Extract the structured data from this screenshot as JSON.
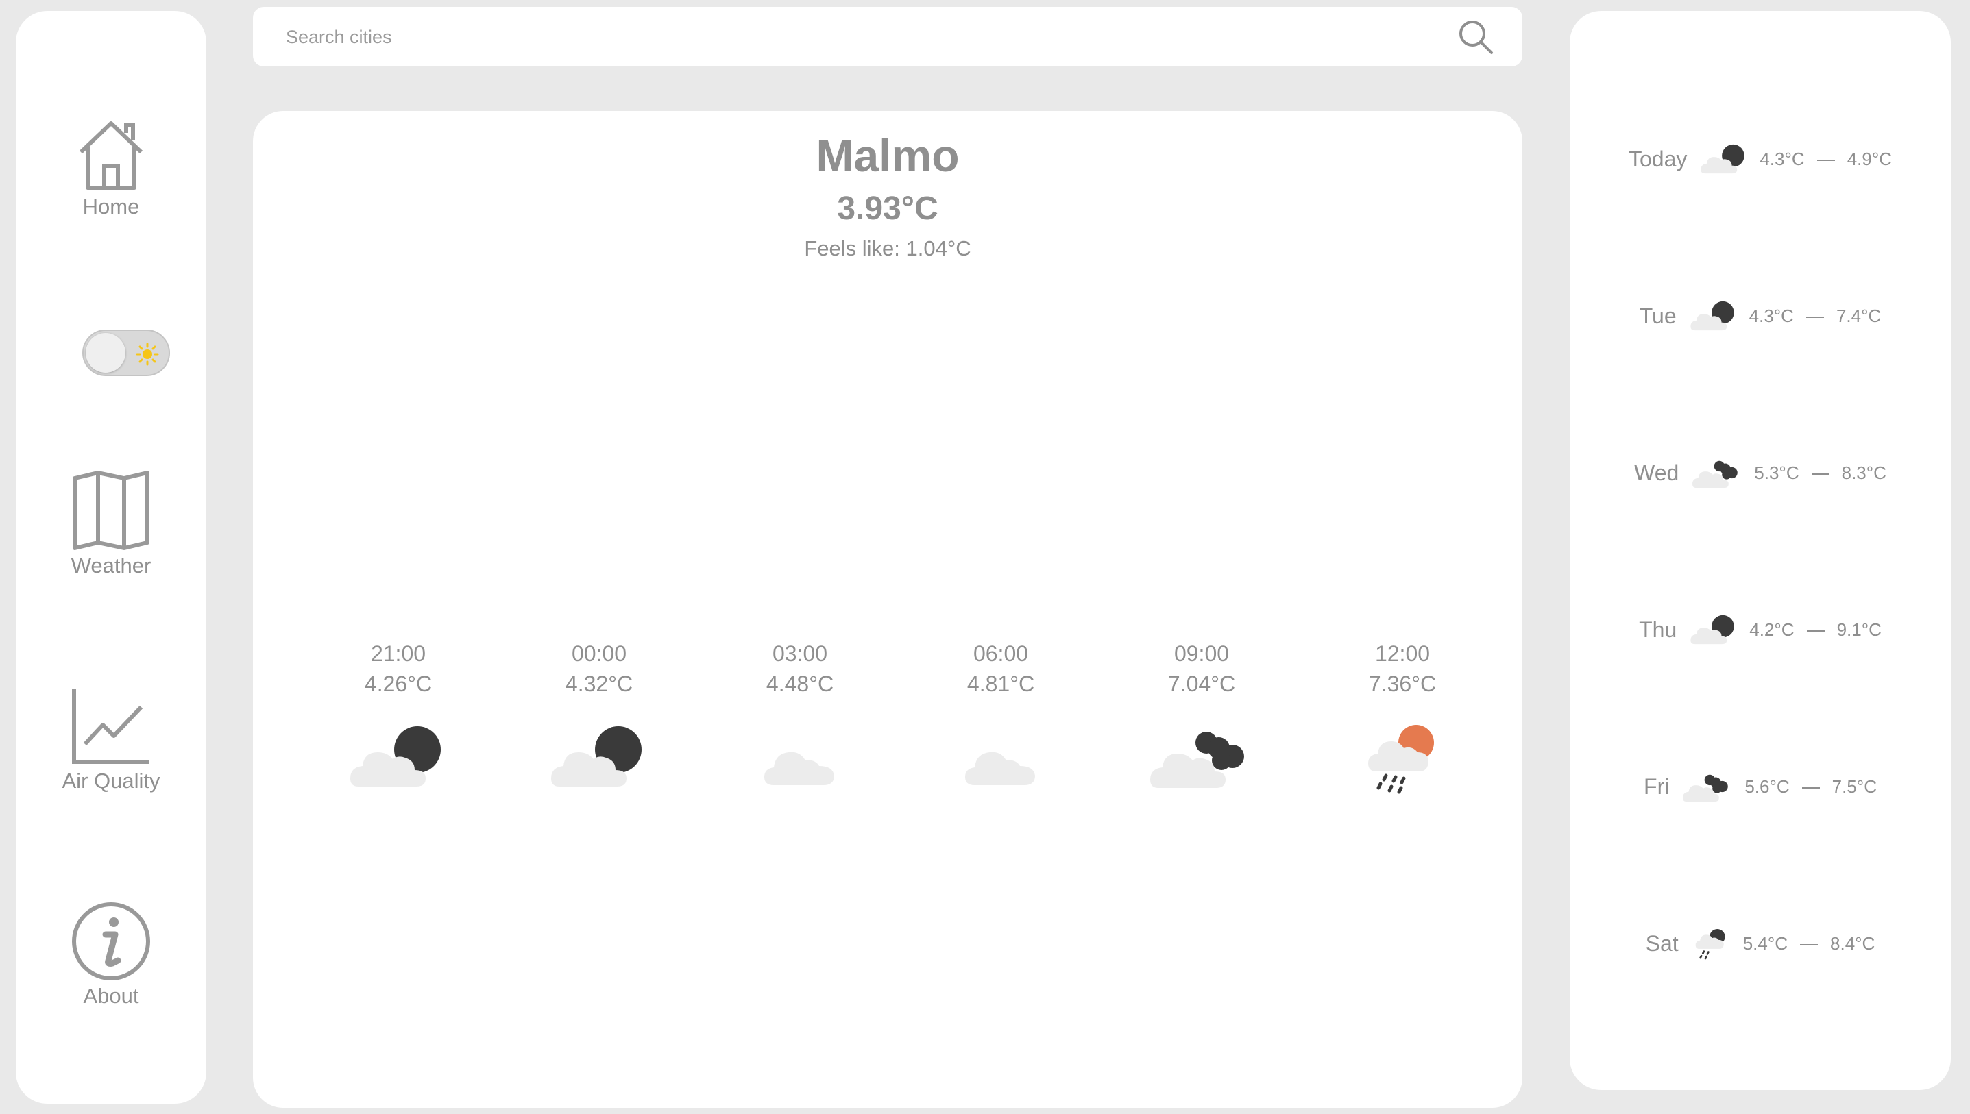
{
  "nav": {
    "items": [
      {
        "label": "Home",
        "icon": "home-icon"
      },
      {
        "label": "Weather",
        "icon": "map-icon"
      },
      {
        "label": "Air Quality",
        "icon": "line-chart-icon"
      },
      {
        "label": "About",
        "icon": "info-icon"
      }
    ],
    "theme_toggle": {
      "icon": "sun-icon",
      "state": "light"
    }
  },
  "search": {
    "placeholder": "Search cities",
    "value": ""
  },
  "current": {
    "city": "Malmo",
    "temperature": "3.93°C",
    "feels_like": "Feels like: 1.04°C"
  },
  "hourly": [
    {
      "time": "21:00",
      "temp": "4.26°C",
      "icon": "cloud-moon-icon"
    },
    {
      "time": "00:00",
      "temp": "4.32°C",
      "icon": "cloud-moon-icon"
    },
    {
      "time": "03:00",
      "temp": "4.48°C",
      "icon": "cloud-icon"
    },
    {
      "time": "06:00",
      "temp": "4.81°C",
      "icon": "cloud-icon"
    },
    {
      "time": "09:00",
      "temp": "7.04°C",
      "icon": "cloud-dark-clouds-icon"
    },
    {
      "time": "12:00",
      "temp": "7.36°C",
      "icon": "rain-sun-icon"
    }
  ],
  "daily": [
    {
      "day": "Today",
      "min": "4.3°C",
      "max": "4.9°C",
      "icon": "cloud-moon-icon"
    },
    {
      "day": "Tue",
      "min": "4.3°C",
      "max": "7.4°C",
      "icon": "cloud-moon-icon"
    },
    {
      "day": "Wed",
      "min": "5.3°C",
      "max": "8.3°C",
      "icon": "cloud-dark-clouds-icon"
    },
    {
      "day": "Thu",
      "min": "4.2°C",
      "max": "9.1°C",
      "icon": "cloud-moon-icon"
    },
    {
      "day": "Fri",
      "min": "5.6°C",
      "max": "7.5°C",
      "icon": "cloud-dark-clouds-icon"
    },
    {
      "day": "Sat",
      "min": "5.4°C",
      "max": "8.4°C",
      "icon": "rain-moon-icon"
    }
  ],
  "colors": {
    "text": "#8f8f8f",
    "background": "#e9e9e9",
    "card": "#ffffff",
    "moon": "#3a3a3a",
    "cloud": "#ececec",
    "sun": "#e57a4f",
    "toggle_sun": "#f5c518"
  }
}
